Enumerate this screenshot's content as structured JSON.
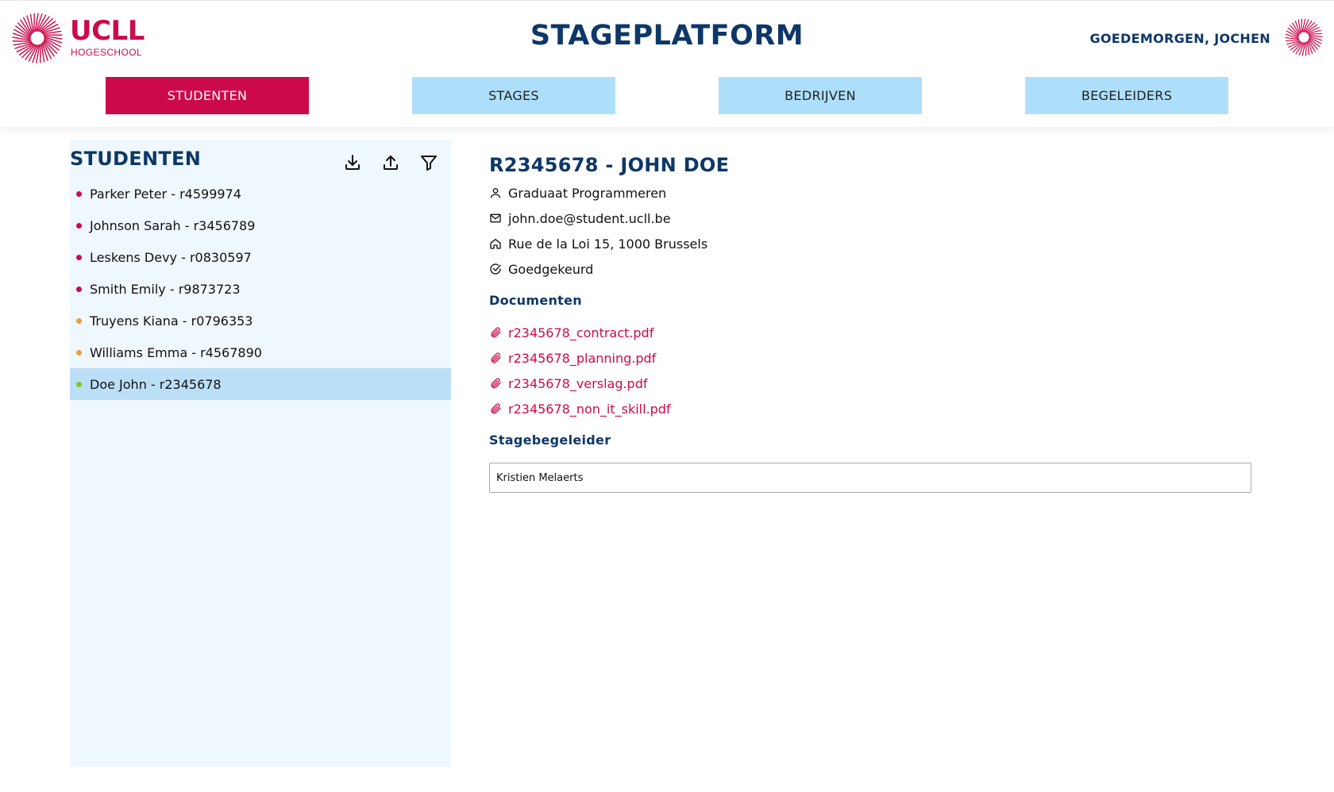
{
  "header": {
    "logo_text": "UCLL",
    "logo_subtitle": "HOGESCHOOL",
    "app_title": "STAGEPLATFORM",
    "greeting": "GOEDEMORGEN, JOCHEN"
  },
  "colors": {
    "brand": "#cc0a4b",
    "navy": "#0d3768",
    "nav_inactive": "#aedffa",
    "sidebar_bg": "#eff8fe",
    "selected_bg": "#bcdff8",
    "status_red": "#cc0a4b",
    "status_orange": "#f39a3a",
    "status_green": "#7cc921"
  },
  "nav": {
    "tabs": [
      {
        "label": "STUDENTEN",
        "active": true
      },
      {
        "label": "STAGES",
        "active": false
      },
      {
        "label": "BEDRIJVEN",
        "active": false
      },
      {
        "label": "BEGELEIDERS",
        "active": false
      }
    ]
  },
  "sidebar": {
    "title": "STUDENTEN",
    "tools": [
      "download-icon",
      "upload-icon",
      "filter-icon"
    ],
    "students": [
      {
        "label": "Parker Peter - r4599974",
        "status": "red",
        "selected": false
      },
      {
        "label": "Johnson Sarah - r3456789",
        "status": "red",
        "selected": false
      },
      {
        "label": "Leskens Devy - r0830597",
        "status": "red",
        "selected": false
      },
      {
        "label": "Smith Emily - r9873723",
        "status": "red",
        "selected": false
      },
      {
        "label": "Truyens Kiana - r0796353",
        "status": "orange",
        "selected": false
      },
      {
        "label": "Williams Emma - r4567890",
        "status": "orange",
        "selected": false
      },
      {
        "label": "Doe John - r2345678",
        "status": "green",
        "selected": true
      }
    ]
  },
  "detail": {
    "title": "R2345678 - JOHN DOE",
    "program": "Graduaat Programmeren",
    "email": "john.doe@student.ucll.be",
    "address": "Rue de la Loi 15, 1000 Brussels",
    "status": "Goedgekeurd",
    "documents_title": "Documenten",
    "documents": [
      "r2345678_contract.pdf",
      "r2345678_planning.pdf",
      "r2345678_verslag.pdf",
      "r2345678_non_it_skill.pdf"
    ],
    "supervisor_title": "Stagebegeleider",
    "supervisor_value": "Kristien Melaerts"
  }
}
